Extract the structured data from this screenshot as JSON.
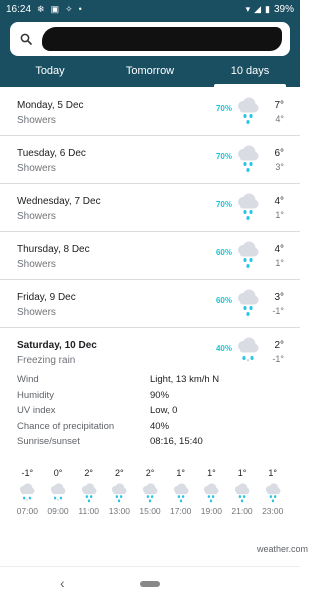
{
  "status_bar": {
    "time": "16:24",
    "battery": "39%",
    "icons": [
      "snowflake-icon",
      "photo-icon",
      "sparkle-icon",
      "dot-icon",
      "wifi-icon",
      "signal-icon",
      "battery-icon"
    ]
  },
  "search": {
    "icon": "search-icon",
    "value_redacted": true
  },
  "tabs": [
    {
      "label": "Today",
      "active": false
    },
    {
      "label": "Tomorrow",
      "active": false
    },
    {
      "label": "10 days",
      "active": true
    }
  ],
  "days": [
    {
      "name": "Monday, 5 Dec",
      "condition": "Showers",
      "precip": "70%",
      "high": "7°",
      "low": "4°",
      "icon": "rain-showers-icon"
    },
    {
      "name": "Tuesday, 6 Dec",
      "condition": "Showers",
      "precip": "70%",
      "high": "6°",
      "low": "3°",
      "icon": "rain-showers-icon"
    },
    {
      "name": "Wednesday, 7 Dec",
      "condition": "Showers",
      "precip": "70%",
      "high": "4°",
      "low": "1°",
      "icon": "rain-showers-icon"
    },
    {
      "name": "Thursday, 8 Dec",
      "condition": "Showers",
      "precip": "60%",
      "high": "4°",
      "low": "1°",
      "icon": "rain-showers-icon"
    },
    {
      "name": "Friday, 9 Dec",
      "condition": "Showers",
      "precip": "60%",
      "high": "3°",
      "low": "-1°",
      "icon": "rain-showers-icon"
    },
    {
      "name": "Saturday, 10 Dec",
      "condition": "Freezing rain",
      "precip": "40%",
      "high": "2°",
      "low": "-1°",
      "icon": "freezing-rain-icon"
    }
  ],
  "details": [
    {
      "label": "Wind",
      "value": "Light, 13 km/h N"
    },
    {
      "label": "Humidity",
      "value": "90%"
    },
    {
      "label": "UV index",
      "value": "Low, 0"
    },
    {
      "label": "Chance of precipitation",
      "value": "40%"
    },
    {
      "label": "Sunrise/sunset",
      "value": "08:16, 15:40"
    }
  ],
  "hourly": [
    {
      "temp": "-1°",
      "time": "07:00",
      "icon": "freezing-rain-icon"
    },
    {
      "temp": "0°",
      "time": "09:00",
      "icon": "freezing-rain-icon"
    },
    {
      "temp": "2°",
      "time": "11:00",
      "icon": "rain-icon"
    },
    {
      "temp": "2°",
      "time": "13:00",
      "icon": "rain-icon"
    },
    {
      "temp": "2°",
      "time": "15:00",
      "icon": "rain-icon"
    },
    {
      "temp": "1°",
      "time": "17:00",
      "icon": "rain-icon"
    },
    {
      "temp": "1°",
      "time": "19:00",
      "icon": "rain-icon"
    },
    {
      "temp": "1°",
      "time": "21:00",
      "icon": "rain-icon"
    },
    {
      "temp": "1°",
      "time": "23:00",
      "icon": "rain-icon"
    }
  ],
  "source": "weather.com",
  "colors": {
    "header": "#1a4f62",
    "precip": "#1dc4d4",
    "cloud": "#d9dde3",
    "drop": "#29c6e0"
  }
}
